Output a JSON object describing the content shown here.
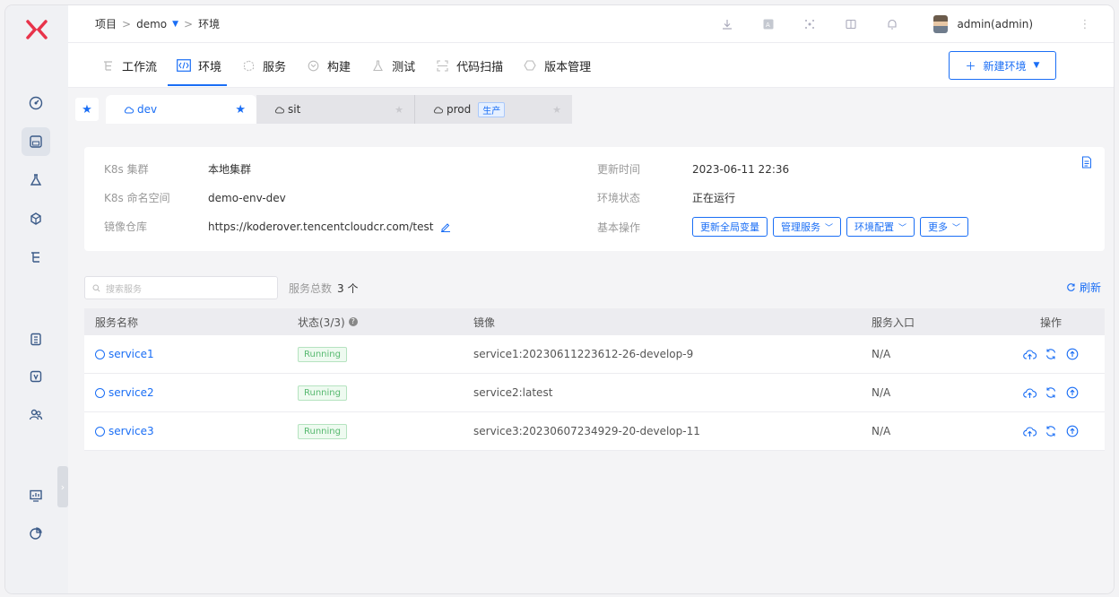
{
  "topbar": {
    "breadcrumb": {
      "project": "项目",
      "sep1": ">",
      "project_name": "demo",
      "sep2": ">",
      "current": "环境"
    },
    "user": "admin(admin)"
  },
  "nav": {
    "tabs": [
      {
        "label": "工作流",
        "icon": "workflow-icon"
      },
      {
        "label": "环境",
        "icon": "code-icon",
        "active": true
      },
      {
        "label": "服务",
        "icon": "service-icon"
      },
      {
        "label": "构建",
        "icon": "build-icon"
      },
      {
        "label": "测试",
        "icon": "test-icon"
      },
      {
        "label": "代码扫描",
        "icon": "scan-icon"
      },
      {
        "label": "版本管理",
        "icon": "version-icon"
      }
    ],
    "new_env_label": "新建环境"
  },
  "env_tabs": [
    {
      "name": "dev",
      "active": true
    },
    {
      "name": "sit",
      "active": false
    },
    {
      "name": "prod",
      "tag": "生产",
      "active": false
    }
  ],
  "info": {
    "cluster_label": "K8s 集群",
    "cluster_value": "本地集群",
    "namespace_label": "K8s 命名空间",
    "namespace_value": "demo-env-dev",
    "registry_label": "镜像仓库",
    "registry_value": "https://koderover.tencentcloudcr.com/test",
    "update_time_label": "更新时间",
    "update_time_value": "2023-06-11 22:36",
    "status_label": "环境状态",
    "status_value": "正在运行",
    "ops_label": "基本操作",
    "ops": {
      "update_vars": "更新全局变量",
      "manage_services": "管理服务",
      "env_config": "环境配置",
      "more": "更多"
    }
  },
  "services": {
    "search_placeholder": "搜索服务",
    "count_label": "服务总数",
    "count_value": "3 个",
    "refresh_label": "刷新",
    "headers": {
      "name": "服务名称",
      "status": "状态(3/3)",
      "image": "镜像",
      "entry": "服务入口",
      "actions": "操作"
    },
    "rows": [
      {
        "name": "service1",
        "status": "Running",
        "image": "service1:20230611223612-26-develop-9",
        "entry": "N/A"
      },
      {
        "name": "service2",
        "status": "Running",
        "image": "service2:latest",
        "entry": "N/A"
      },
      {
        "name": "service3",
        "status": "Running",
        "image": "service3:20230607234929-20-develop-11",
        "entry": "N/A"
      }
    ]
  },
  "colors": {
    "accent": "#1a6ef5",
    "running": "#57b96f",
    "logo": "#e8334a"
  }
}
